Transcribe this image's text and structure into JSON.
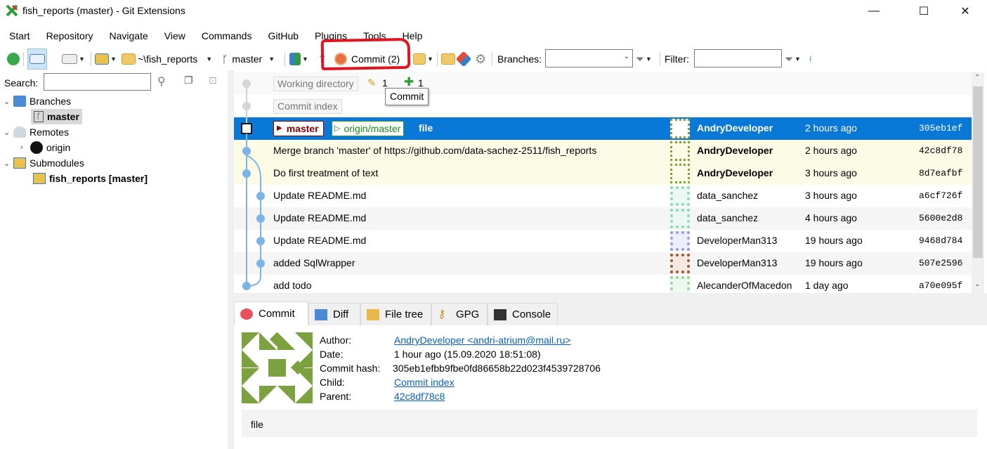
{
  "window": {
    "title": "fish_reports (master) - Git Extensions",
    "minimize": "—",
    "maximize": "☐",
    "close": "✕"
  },
  "menu": [
    "Start",
    "Repository",
    "Navigate",
    "View",
    "Commands",
    "GitHub",
    "Plugins",
    "Tools",
    "Help"
  ],
  "toolbar": {
    "repo_path": "~\\fish_reports",
    "branch": "master",
    "commit_label": "Commit (2)",
    "branches_label": "Branches:",
    "filter_label": "Filter:"
  },
  "tooltip": "Commit",
  "left_panel": {
    "search_label": "Search:",
    "tree": {
      "branches": "Branches",
      "master": "master",
      "remotes": "Remotes",
      "origin": "origin",
      "submodules": "Submodules",
      "submodule_item": "fish_reports [master]"
    }
  },
  "grid": {
    "working_directory": "Working directory",
    "wd_modified": "1",
    "wd_added": "1",
    "commit_index": "Commit index",
    "badge_master": "master",
    "badge_origin": "origin/master",
    "rows": [
      {
        "message": "file",
        "author": "AndryDeveloper",
        "date": "2 hours ago",
        "hash": "305eb1ef"
      },
      {
        "message": "Merge branch 'master' of https://github.com/data-sachez-2511/fish_reports",
        "author": "AndryDeveloper",
        "date": "2 hours ago",
        "hash": "42c8df78"
      },
      {
        "message": "Do first treatment of text",
        "author": "AndryDeveloper",
        "date": "3 hours ago",
        "hash": "8d7eafbf"
      },
      {
        "message": "Update README.md",
        "author": "data_sanchez",
        "date": "3 hours ago",
        "hash": "a6cf726f"
      },
      {
        "message": "Update README.md",
        "author": "data_sanchez",
        "date": "4 hours ago",
        "hash": "5600e2d8"
      },
      {
        "message": "Update README.md",
        "author": "DeveloperMan313",
        "date": "19 hours ago",
        "hash": "9468d784"
      },
      {
        "message": "added SqlWrapper",
        "author": "DeveloperMan313",
        "date": "19 hours ago",
        "hash": "507e2596"
      },
      {
        "message": "add todo",
        "author": "AlecanderOfMacedon",
        "date": "1 day ago",
        "hash": "a70e095f"
      }
    ]
  },
  "tabs": [
    "Commit",
    "Diff",
    "File tree",
    "GPG",
    "Console"
  ],
  "details": {
    "author_label": "Author:",
    "author": "AndryDeveloper <andri-atrium@mail.ru>",
    "date_label": "Date:",
    "date": "1 hour ago (15.09.2020 18:51:08)",
    "hash_label": "Commit hash:",
    "hash": "305eb1efbb9fbe0fd86658b22d023f4539728706",
    "child_label": "Child:",
    "child": "Commit index",
    "parent_label": "Parent:",
    "parent": "42c8df78c8",
    "message": "file"
  },
  "colors": {
    "selection": "#0a78d7",
    "highlight_row": "#fcfce6",
    "graph_line": "#7db4e8",
    "annotation_red": "#e0141e",
    "avatar_green": "#7ba23f"
  }
}
